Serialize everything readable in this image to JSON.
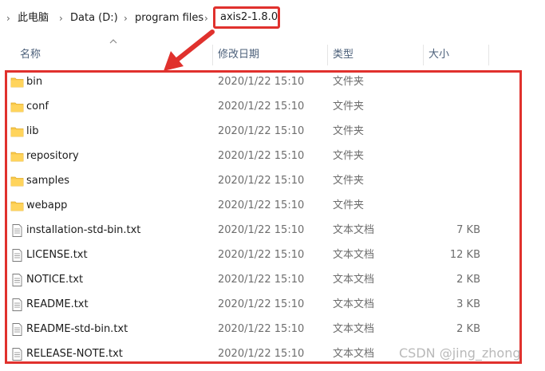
{
  "breadcrumb": {
    "items": [
      "此电脑",
      "Data (D:)",
      "program files",
      "axis2-1.8.0"
    ],
    "separator": "›"
  },
  "columns": {
    "name": "名称",
    "date": "修改日期",
    "type": "类型",
    "size": "大小"
  },
  "files": [
    {
      "name": "bin",
      "date": "2020/1/22 15:10",
      "type": "文件夹",
      "size": "",
      "icon": "folder-icon"
    },
    {
      "name": "conf",
      "date": "2020/1/22 15:10",
      "type": "文件夹",
      "size": "",
      "icon": "folder-icon"
    },
    {
      "name": "lib",
      "date": "2020/1/22 15:10",
      "type": "文件夹",
      "size": "",
      "icon": "folder-icon"
    },
    {
      "name": "repository",
      "date": "2020/1/22 15:10",
      "type": "文件夹",
      "size": "",
      "icon": "folder-icon"
    },
    {
      "name": "samples",
      "date": "2020/1/22 15:10",
      "type": "文件夹",
      "size": "",
      "icon": "folder-icon"
    },
    {
      "name": "webapp",
      "date": "2020/1/22 15:10",
      "type": "文件夹",
      "size": "",
      "icon": "folder-icon"
    },
    {
      "name": "installation-std-bin.txt",
      "date": "2020/1/22 15:10",
      "type": "文本文档",
      "size": "7 KB",
      "icon": "text-file-icon"
    },
    {
      "name": "LICENSE.txt",
      "date": "2020/1/22 15:10",
      "type": "文本文档",
      "size": "12 KB",
      "icon": "text-file-icon"
    },
    {
      "name": "NOTICE.txt",
      "date": "2020/1/22 15:10",
      "type": "文本文档",
      "size": "2 KB",
      "icon": "text-file-icon"
    },
    {
      "name": "README.txt",
      "date": "2020/1/22 15:10",
      "type": "文本文档",
      "size": "3 KB",
      "icon": "text-file-icon"
    },
    {
      "name": "README-std-bin.txt",
      "date": "2020/1/22 15:10",
      "type": "文本文档",
      "size": "2 KB",
      "icon": "text-file-icon"
    },
    {
      "name": "RELEASE-NOTE.txt",
      "date": "2020/1/22 15:10",
      "type": "文本文档",
      "size": "",
      "icon": "text-file-icon"
    }
  ],
  "watermark": "CSDN @jing_zhong",
  "colors": {
    "annotation": "#e0312d",
    "folder": "#f8c94a",
    "header_text": "#4c607a"
  }
}
